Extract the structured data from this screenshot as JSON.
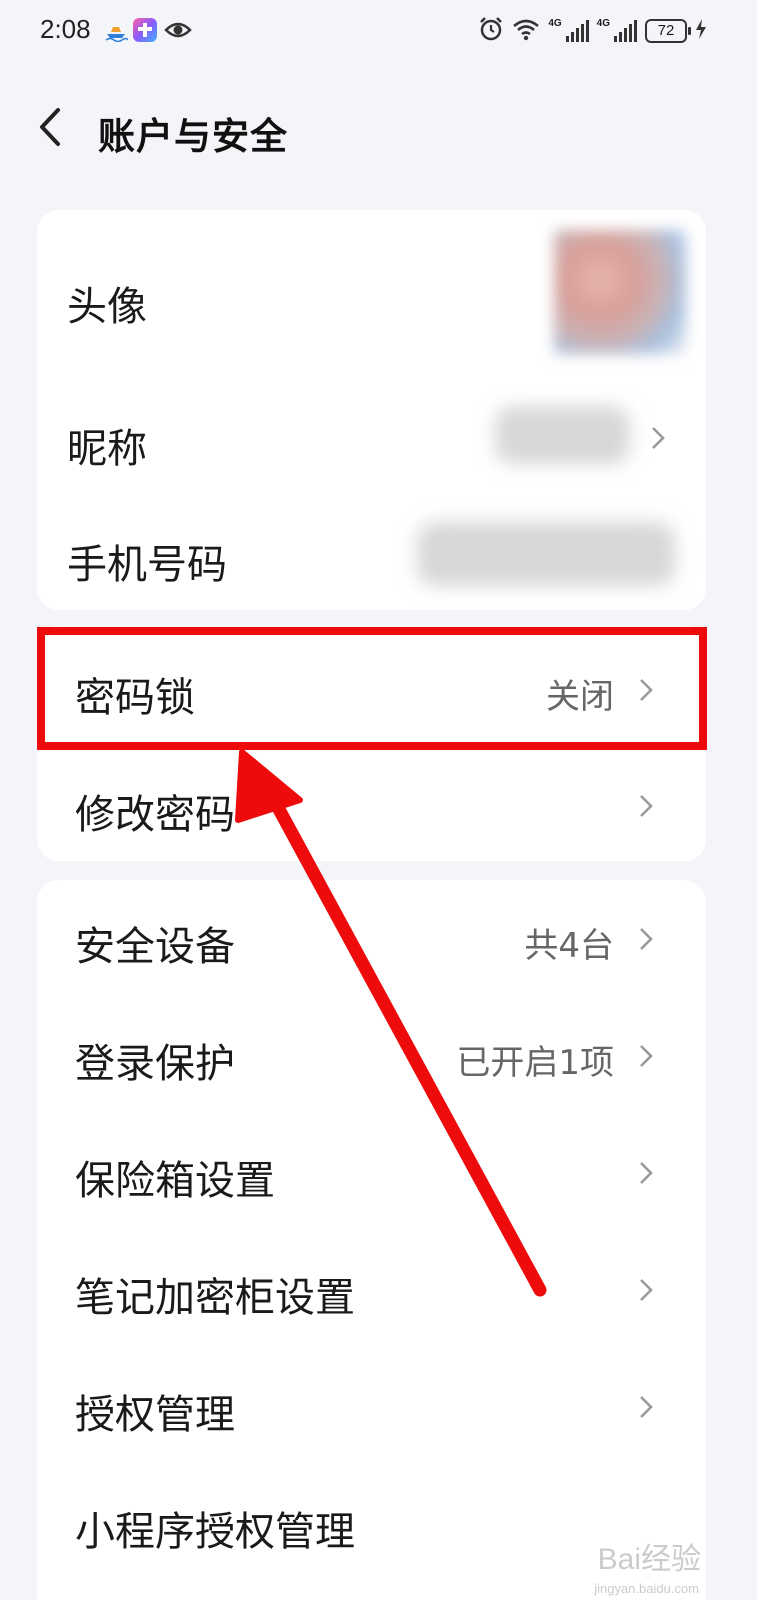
{
  "status_bar": {
    "time": "2:08",
    "network_1": "4G",
    "network_2": "4G",
    "battery": "72"
  },
  "header": {
    "title": "账户与安全"
  },
  "profile": {
    "avatar_label": "头像",
    "nickname_label": "昵称",
    "phone_label": "手机号码"
  },
  "security": {
    "lock_label": "密码锁",
    "lock_value": "关闭",
    "change_password_label": "修改密码"
  },
  "settings": {
    "items": [
      {
        "label": "安全设备",
        "value": "共4台"
      },
      {
        "label": "登录保护",
        "value": "已开启1项"
      },
      {
        "label": "保险箱设置",
        "value": ""
      },
      {
        "label": "笔记加密柜设置",
        "value": ""
      },
      {
        "label": "授权管理",
        "value": ""
      },
      {
        "label": "小程序授权管理",
        "value": ""
      }
    ]
  },
  "watermark": {
    "text": "Bai经验",
    "sub": "jingyan.baidu.com"
  },
  "colors": {
    "background": "#f4f5f9",
    "card": "#ffffff",
    "highlight": "#ee0b0b",
    "secondary_text": "#666666"
  }
}
